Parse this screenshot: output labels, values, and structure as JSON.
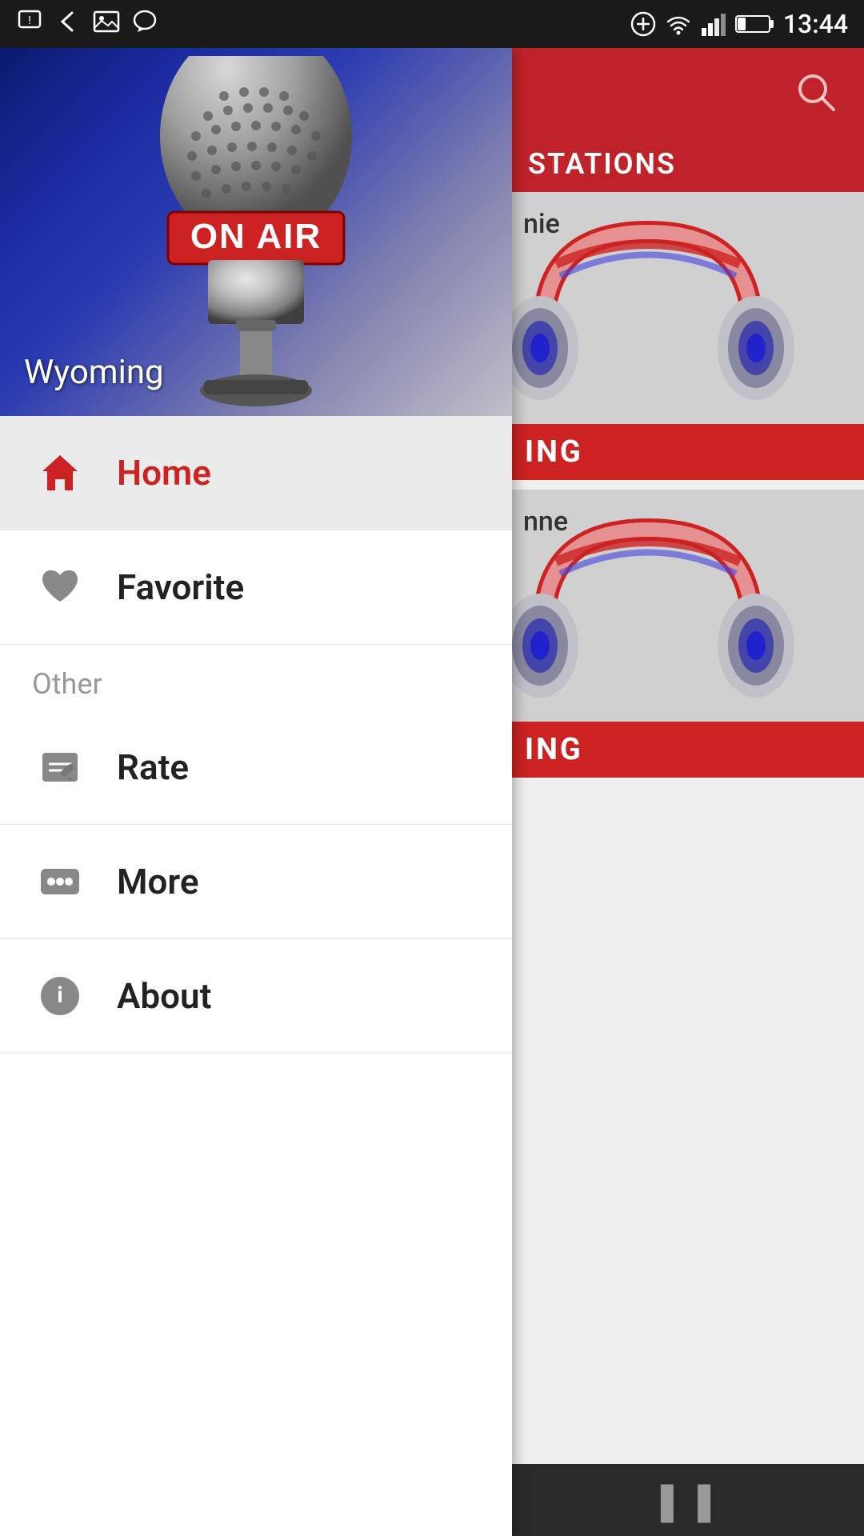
{
  "statusBar": {
    "time": "13:44",
    "batteryLevel": "23%"
  },
  "hero": {
    "location": "Wyoming",
    "imageAlt": "On Air Microphone"
  },
  "nav": {
    "items": [
      {
        "id": "home",
        "label": "Home",
        "icon": "home-icon",
        "active": true,
        "labelColor": "red"
      },
      {
        "id": "favorite",
        "label": "Favorite",
        "icon": "heart-icon",
        "active": false,
        "labelColor": "dark"
      }
    ],
    "otherSectionLabel": "Other",
    "otherItems": [
      {
        "id": "rate",
        "label": "Rate",
        "icon": "rate-icon"
      },
      {
        "id": "more",
        "label": "More",
        "icon": "more-icon"
      },
      {
        "id": "about",
        "label": "About",
        "icon": "about-icon"
      }
    ]
  },
  "rightPanel": {
    "stationsLabel": "STATIONS",
    "stations": [
      {
        "id": "station1",
        "partialLabel": "nie"
      },
      {
        "id": "station2",
        "partialLabel": "nne"
      }
    ],
    "wyomingBadgeText": "ING"
  },
  "player": {
    "pauseLabel": "❚❚"
  }
}
